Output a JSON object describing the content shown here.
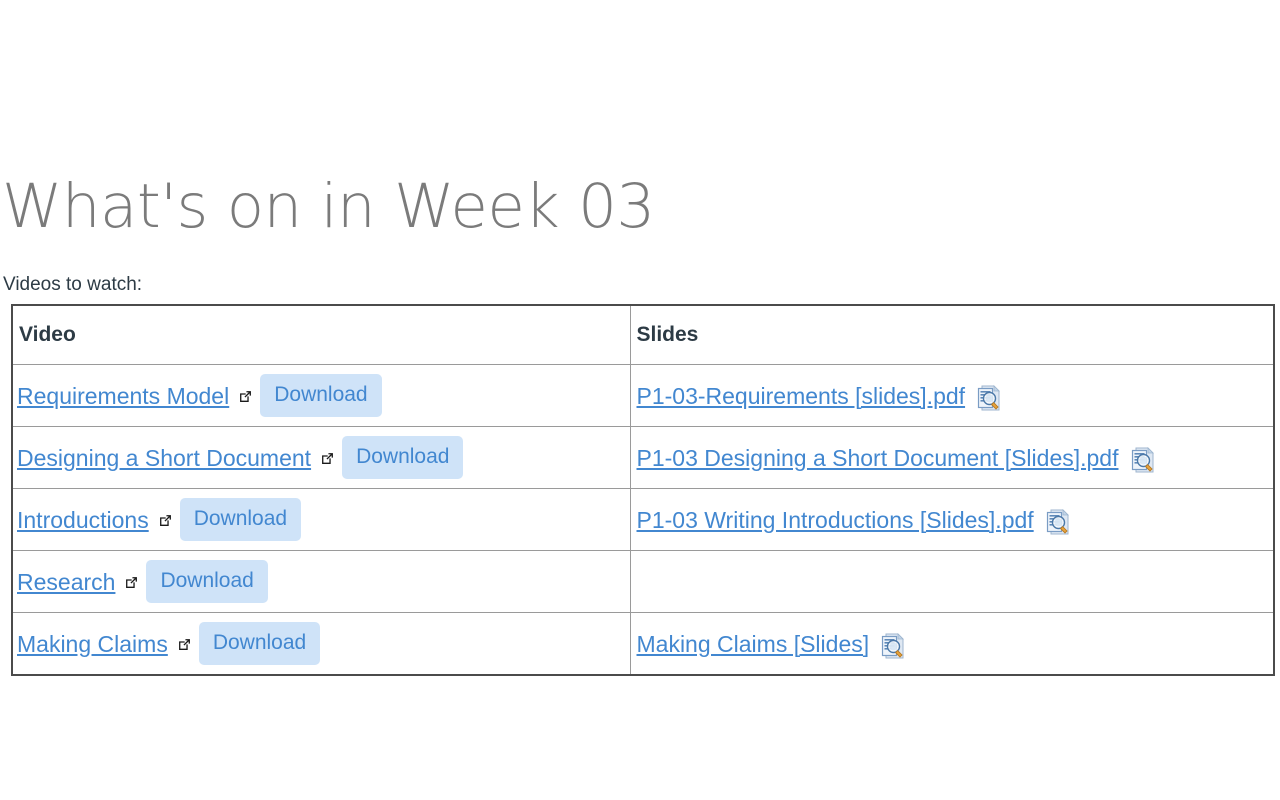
{
  "page": {
    "title": "What's on in Week 03",
    "intro": "Videos to watch:"
  },
  "table": {
    "columns": [
      {
        "key": "video",
        "label": "Video"
      },
      {
        "key": "slides",
        "label": "Slides"
      }
    ],
    "download_label": "Download",
    "icons": {
      "external": "external-link-icon",
      "preview": "document-preview-icon"
    },
    "rows": [
      {
        "video_label": "Requirements Model",
        "has_download": true,
        "slides_label": "P1-03-Requirements [slides].pdf",
        "has_slides": true
      },
      {
        "video_label": "Designing a Short Document",
        "has_download": true,
        "slides_label": "P1-03 Designing a Short Document [Slides].pdf",
        "has_slides": true
      },
      {
        "video_label": "Introductions",
        "has_download": true,
        "slides_label": "P1-03 Writing Introductions [Slides].pdf",
        "has_slides": true
      },
      {
        "video_label": "Research",
        "has_download": true,
        "slides_label": "",
        "has_slides": false
      },
      {
        "video_label": "Making Claims",
        "has_download": true,
        "slides_label": "Making Claims [Slides]",
        "has_slides": true
      }
    ]
  },
  "colors": {
    "link": "#4287d0",
    "download_bg": "#cfe3f8",
    "title_text": "#7b7b7b",
    "body_text": "#2d3b45",
    "table_outer_border": "#4b4b4b",
    "table_inner_border": "#9a9a9a",
    "page_background": "#ffffff"
  }
}
